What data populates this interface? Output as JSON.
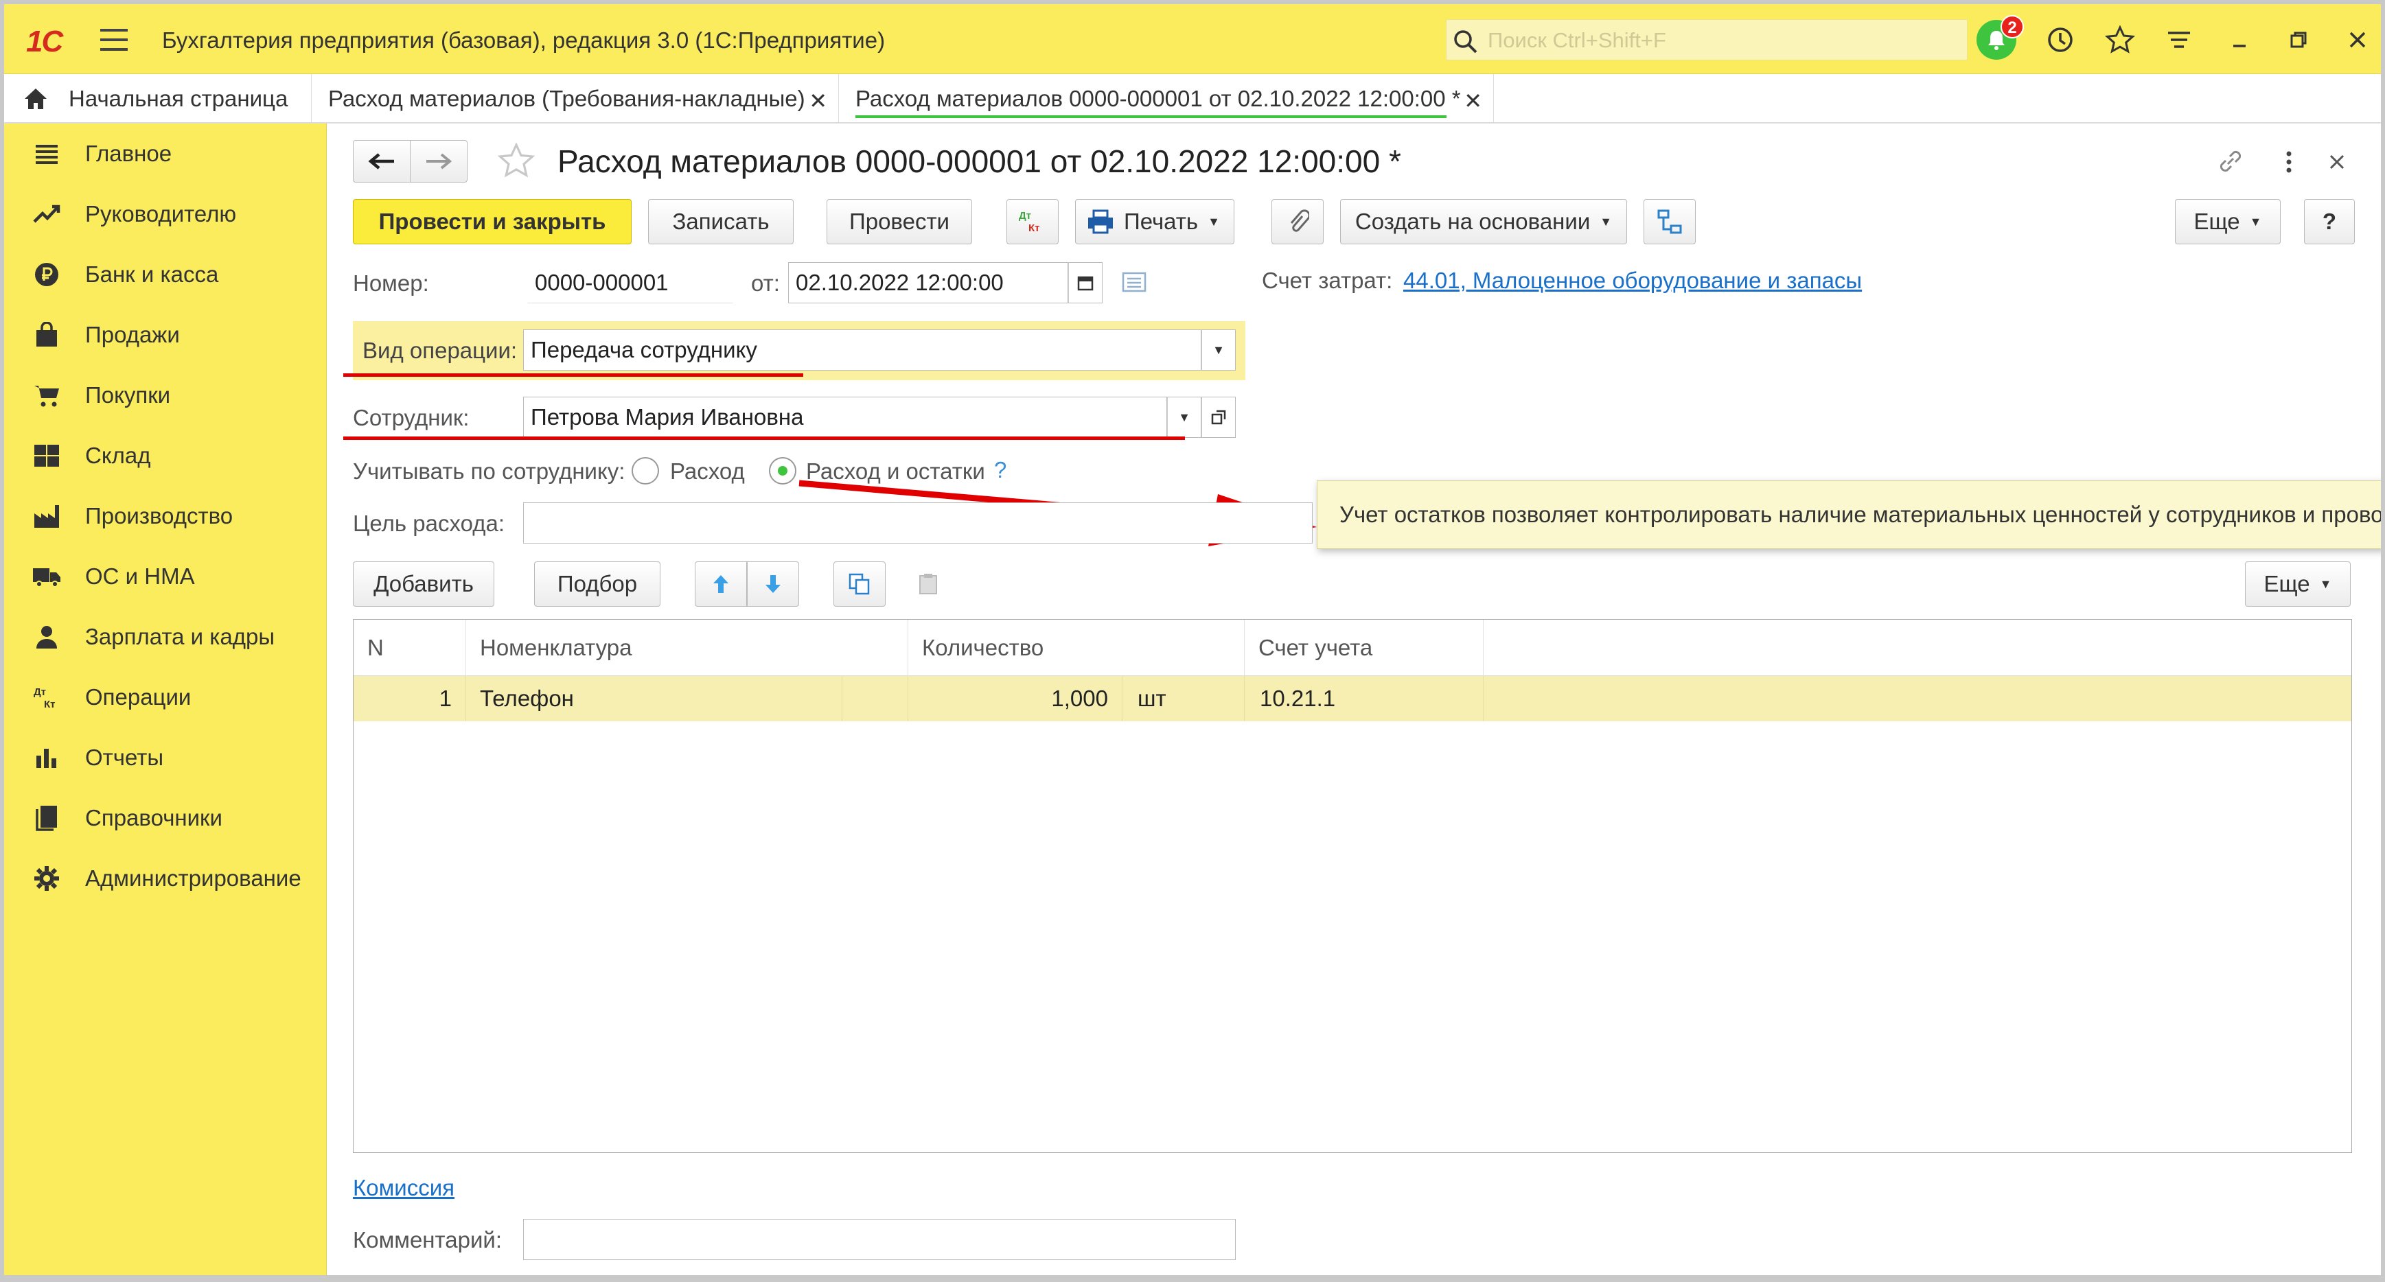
{
  "app": {
    "title": "Бухгалтерия предприятия (базовая), редакция 3.0  (1С:Предприятие)",
    "logo": "1С",
    "search_placeholder": "Поиск Ctrl+Shift+F",
    "notification_count": "2"
  },
  "tabs": [
    {
      "label": "Начальная страница"
    },
    {
      "label": "Расход материалов (Требования-накладные)"
    },
    {
      "label": "Расход материалов 0000-000001 от 02.10.2022 12:00:00 *"
    }
  ],
  "sidebar": {
    "items": [
      {
        "label": "Главное",
        "icon": "menu-lines-icon"
      },
      {
        "label": "Руководителю",
        "icon": "trend-icon"
      },
      {
        "label": "Банк и касса",
        "icon": "ruble-coin-icon"
      },
      {
        "label": "Продажи",
        "icon": "shopping-bag-icon"
      },
      {
        "label": "Покупки",
        "icon": "cart-icon"
      },
      {
        "label": "Склад",
        "icon": "warehouse-icon"
      },
      {
        "label": "Производство",
        "icon": "factory-icon"
      },
      {
        "label": "ОС и НМА",
        "icon": "truck-icon"
      },
      {
        "label": "Зарплата и кадры",
        "icon": "person-icon"
      },
      {
        "label": "Операции",
        "icon": "dt-kt-icon"
      },
      {
        "label": "Отчеты",
        "icon": "bar-chart-icon"
      },
      {
        "label": "Справочники",
        "icon": "book-icon"
      },
      {
        "label": "Администрирование",
        "icon": "gear-icon"
      }
    ]
  },
  "document": {
    "title": "Расход материалов 0000-000001 от 02.10.2022 12:00:00 *",
    "toolbar": {
      "post_and_close": "Провести и закрыть",
      "save": "Записать",
      "post": "Провести",
      "print": "Печать",
      "create_based_on": "Создать на основании",
      "more": "Еще",
      "help": "?"
    },
    "number_label": "Номер:",
    "number_value": "0000-000001",
    "date_label": "от:",
    "date_value": "02.10.2022 12:00:00",
    "cost_account_label": "Счет затрат:",
    "cost_account_value": "44.01, Малоценное оборудование и запасы",
    "operation_label": "Вид операции:",
    "operation_value": "Передача сотруднику",
    "employee_label": "Сотрудник:",
    "employee_value": "Петрова Мария Ивановна",
    "track_label": "Учитывать по сотруднику:",
    "radio_expense": "Расход",
    "radio_expense_balance": "Расход и остатки",
    "help_mark": "?",
    "purpose_label": "Цель расхода:",
    "purpose_value": "",
    "tooltip": "Учет остатков позволяет контролировать наличие материальных ценностей у сотрудников и проводить инвентаризации",
    "table_toolbar": {
      "add": "Добавить",
      "pick": "Подбор",
      "more": "Еще"
    },
    "table": {
      "columns": [
        "N",
        "Номенклатура",
        "Количество",
        "Счет учета"
      ],
      "rows": [
        {
          "n": "1",
          "item": "Телефон",
          "qty": "1,000",
          "unit": "шт",
          "account": "10.21.1"
        }
      ]
    },
    "commission_link": "Комиссия",
    "comment_label": "Комментарий:",
    "comment_value": ""
  }
}
